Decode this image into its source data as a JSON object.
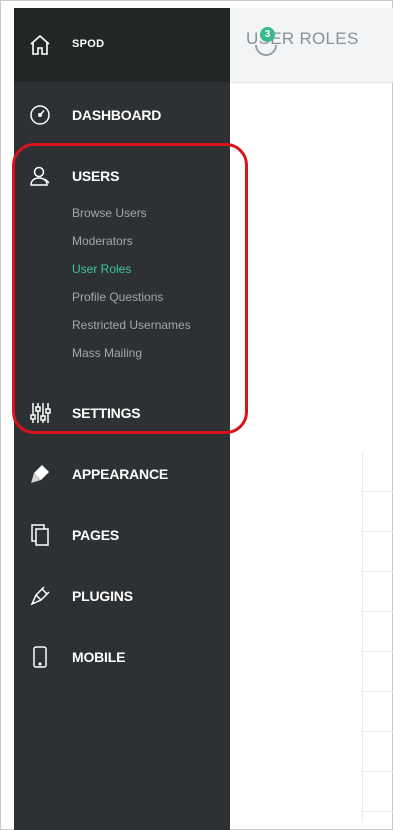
{
  "brand": {
    "name": "SPOD",
    "icon": "home-icon"
  },
  "nav": {
    "dashboard": {
      "label": "DASHBOARD",
      "icon": "gauge-icon"
    },
    "users": {
      "label": "USERS",
      "icon": "user-icon",
      "sub": [
        {
          "label": "Browse Users",
          "active": false
        },
        {
          "label": "Moderators",
          "active": false
        },
        {
          "label": "User Roles",
          "active": true
        },
        {
          "label": "Profile Questions",
          "active": false
        },
        {
          "label": "Restricted Usernames",
          "active": false
        },
        {
          "label": "Mass Mailing",
          "active": false
        }
      ]
    },
    "settings": {
      "label": "SETTINGS",
      "icon": "sliders-icon"
    },
    "appearance": {
      "label": "APPEARANCE",
      "icon": "brush-icon"
    },
    "pages": {
      "label": "PAGES",
      "icon": "pages-icon"
    },
    "plugins": {
      "label": "PLUGINS",
      "icon": "plug-icon"
    },
    "mobile": {
      "label": "MOBILE",
      "icon": "mobile-icon"
    }
  },
  "header": {
    "title": "USER ROLES",
    "badge_count": "3"
  },
  "colors": {
    "sidebar": "#2d3133",
    "brand_bar": "#232627",
    "active": "#3fc7a0",
    "highlight": "#d8141a"
  }
}
